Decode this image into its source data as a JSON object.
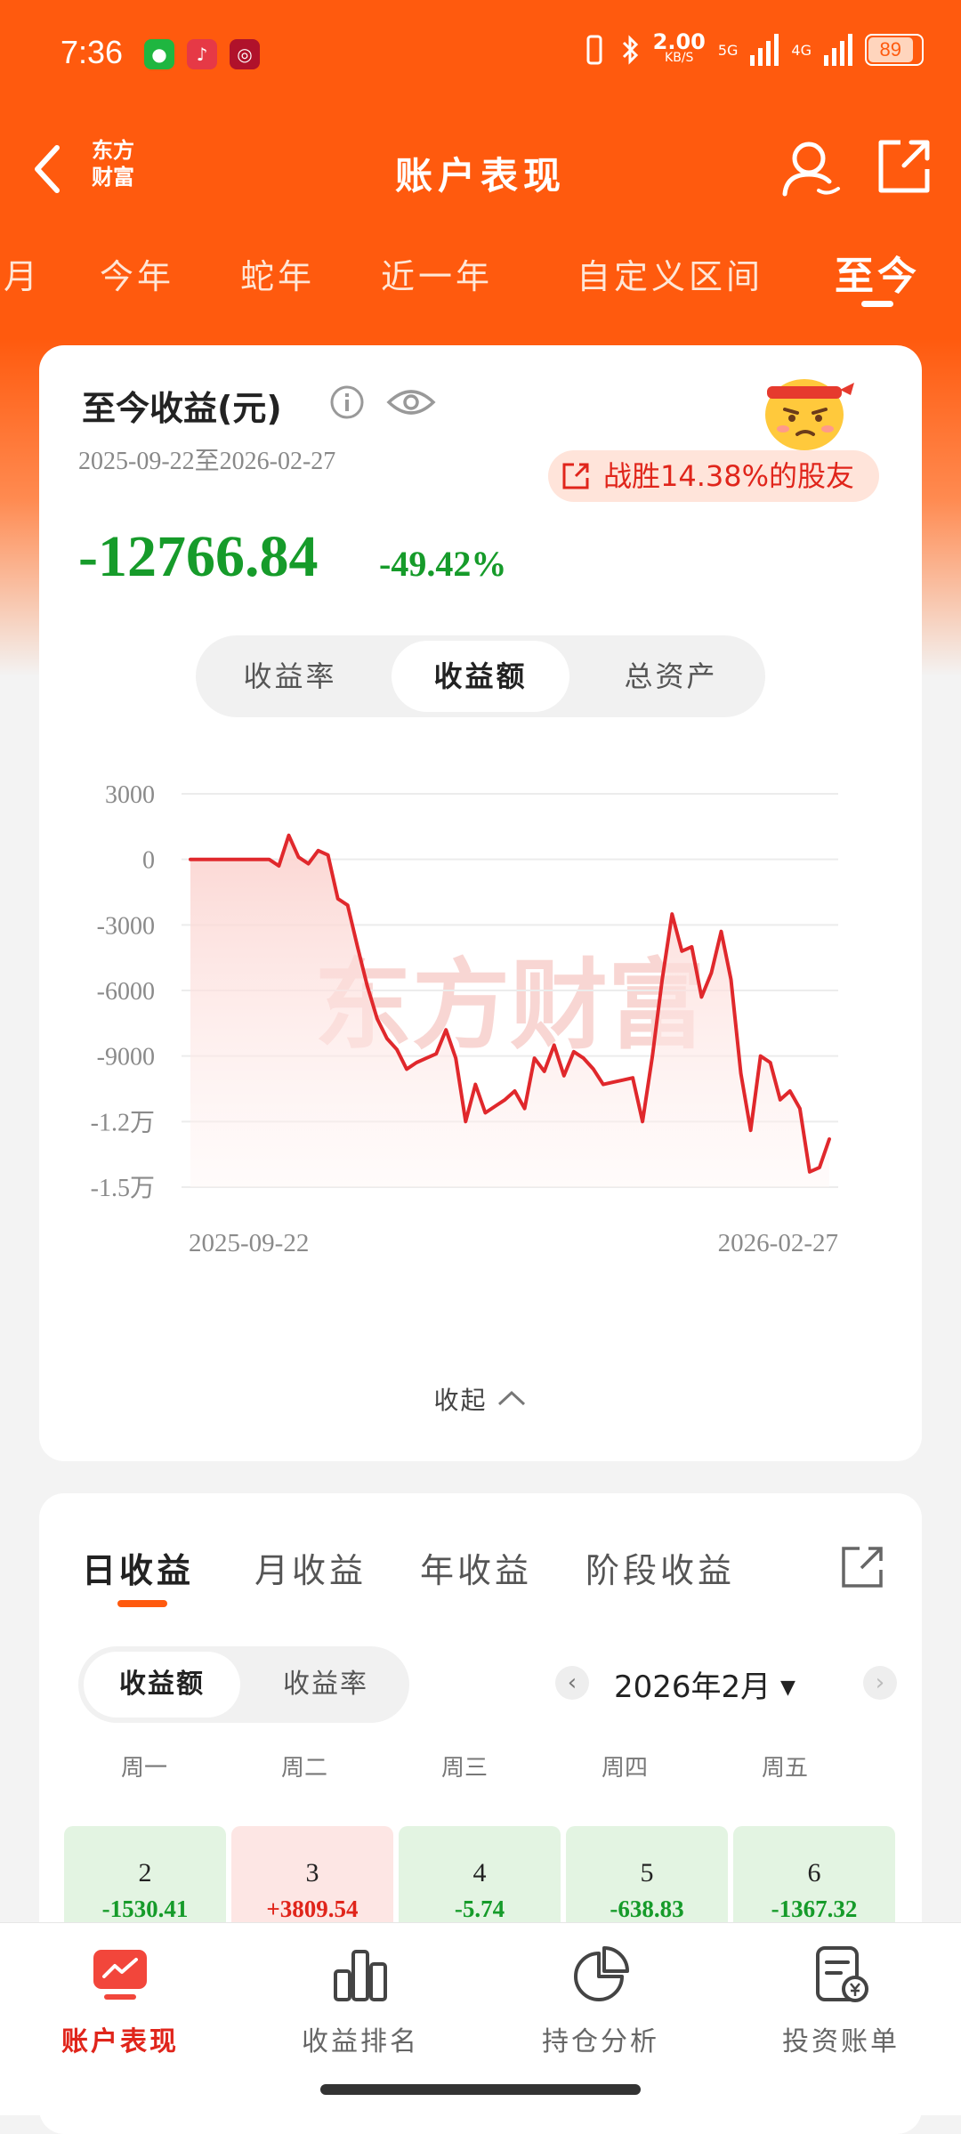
{
  "status": {
    "time": "7:36",
    "net_speed": "2.00",
    "net_unit": "KB/S",
    "sig1": "5G",
    "sig2": "4G",
    "battery": "89"
  },
  "nav": {
    "logo_line1": "东方",
    "logo_line2": "财富",
    "title": "账户表现"
  },
  "period_tabs": [
    "月",
    "今年",
    "蛇年",
    "近一年",
    "自定义区间",
    "至今"
  ],
  "summary": {
    "title": "至今收益(元)",
    "date_range": "2025-09-22至2026-02-27",
    "beat_text": "战胜14.38%的股友",
    "profit": "-12766.84",
    "percent": "-49.42%",
    "segments": [
      "收益率",
      "收益额",
      "总资产"
    ],
    "active_segment": "收益额",
    "collapse_label": "收起"
  },
  "chart_data": {
    "type": "line",
    "ylim": [
      -15000,
      3000
    ],
    "yticks": [
      3000,
      0,
      -3000,
      -6000,
      -9000,
      -12000,
      -15000
    ],
    "ytick_labels": [
      "3000",
      "0",
      "-3000",
      "-6000",
      "-9000",
      "-1.2万",
      "-1.5万"
    ],
    "x_start": "2025-09-22",
    "x_end": "2026-02-27",
    "xtick_labels": [
      "2025-09-22",
      "2026-02-27"
    ],
    "watermark": "东方财富",
    "color": "#e0282c",
    "grid": true,
    "series": [
      {
        "values": [
          0,
          0,
          0,
          0,
          0,
          0,
          0,
          0,
          0,
          -300,
          1100,
          100,
          -200,
          400,
          200,
          -1800,
          -2100,
          -4000,
          -5800,
          -7300,
          -8200,
          -8700,
          -9600,
          -9300,
          -9100,
          -8900,
          -7800,
          -9100,
          -12000,
          -10300,
          -11600,
          -11300,
          -11000,
          -10600,
          -11400,
          -9100,
          -9700,
          -8500,
          -9900,
          -8800,
          -9100,
          -9600,
          -10300,
          -10200,
          -10100,
          -10000,
          -12000,
          -9000,
          -5500,
          -2500,
          -4200,
          -4000,
          -6300,
          -5200,
          -3300,
          -5500,
          -9800,
          -12400,
          -9000,
          -9300,
          -11000,
          -10600,
          -11400,
          -14300,
          -14100,
          -12800
        ]
      }
    ]
  },
  "daily": {
    "tabs": [
      "日收益",
      "月收益",
      "年收益",
      "阶段收益"
    ],
    "active_tab": "日收益",
    "segments": [
      "收益额",
      "收益率"
    ],
    "active_segment": "收益额",
    "month_label": "2026年2月",
    "weekdays": [
      "周一",
      "周二",
      "周三",
      "周四",
      "周五"
    ],
    "days": [
      {
        "day": "2",
        "value": "-1530.41",
        "trend": "down"
      },
      {
        "day": "3",
        "value": "+3809.54",
        "trend": "up"
      },
      {
        "day": "4",
        "value": "-5.74",
        "trend": "down"
      },
      {
        "day": "5",
        "value": "-638.83",
        "trend": "down"
      },
      {
        "day": "6",
        "value": "-1367.32",
        "trend": "down"
      }
    ]
  },
  "bottom_nav": [
    "账户表现",
    "收益排名",
    "持仓分析",
    "投资账单"
  ],
  "colors": {
    "brand": "#ff5a0e",
    "loss": "#169b2a",
    "gain": "#e0251b"
  }
}
